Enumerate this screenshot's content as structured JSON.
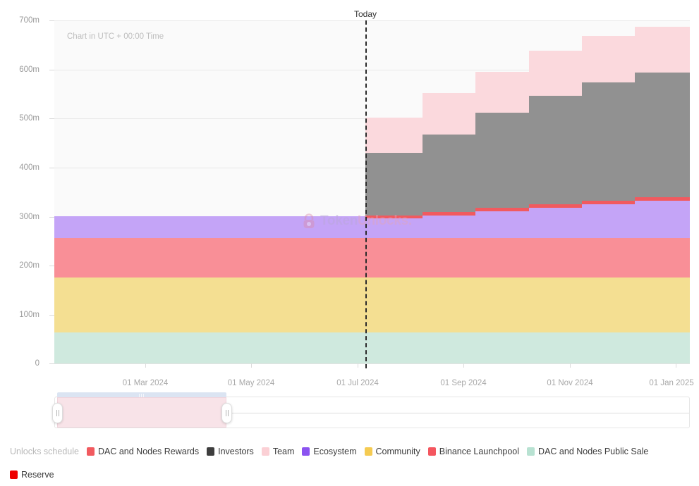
{
  "chart_data": {
    "type": "area",
    "title": "",
    "subtitle": "Chart in UTC + 00:00 Time",
    "xlabel": "",
    "ylabel": "",
    "ylim": [
      0,
      700000000
    ],
    "y_ticks": [
      "0",
      "100m",
      "200m",
      "300m",
      "400m",
      "500m",
      "600m",
      "700m"
    ],
    "y_tick_values": [
      0,
      100000000,
      200000000,
      300000000,
      400000000,
      500000000,
      600000000,
      700000000
    ],
    "x_ticks": [
      "01 Mar 2024",
      "01 May 2024",
      "01 Jul 2024",
      "01 Sep 2024",
      "01 Nov 2024",
      "01 Jan 2025"
    ],
    "grid": true,
    "legend_position": "bottom",
    "stacked": true,
    "step_shape": "hv",
    "annotations": [
      {
        "name": "today-marker",
        "label": "Today",
        "x": "01 Jul 2024",
        "style": "dashed-vertical"
      },
      {
        "name": "timezone-note",
        "label": "Chart in UTC + 00:00 Time"
      },
      {
        "name": "watermark",
        "label": "TokenUnlocks."
      }
    ],
    "x": [
      "01 Feb 2024",
      "01 Jul 2024",
      "01 Aug 2024",
      "01 Sep 2024",
      "01 Oct 2024",
      "01 Nov 2024",
      "01 Dec 2024",
      "01 Jan 2025"
    ],
    "series": [
      {
        "name": "DAC and Nodes Public Sale",
        "color": "#cfe9de",
        "values": [
          50000000,
          50000000,
          50000000,
          50000000,
          50000000,
          50000000,
          50000000,
          50000000
        ]
      },
      {
        "name": "Community",
        "color": "#f4df92",
        "values": [
          130000000,
          130000000,
          130000000,
          130000000,
          130000000,
          130000000,
          130000000,
          130000000
        ]
      },
      {
        "name": "Binance Launchpool",
        "color": "#f98f97",
        "values": [
          75000000,
          75000000,
          75000000,
          75000000,
          75000000,
          75000000,
          75000000,
          75000000
        ]
      },
      {
        "name": "Ecosystem",
        "color": "#c4a4f7",
        "values": [
          45000000,
          45000000,
          45000000,
          45000000,
          45000000,
          45000000,
          45000000,
          45000000
        ]
      },
      {
        "name": "DAC and Nodes Rewards",
        "color": "#f15a5f",
        "values": [
          0,
          3000000,
          5000000,
          7000000,
          9000000,
          11000000,
          13000000,
          15000000
        ]
      },
      {
        "name": "Investors",
        "color": "#919191",
        "values": [
          0,
          110000000,
          125000000,
          140000000,
          155000000,
          170000000,
          185000000,
          197000000
        ]
      },
      {
        "name": "Team",
        "color": "#fbd9dd",
        "values": [
          0,
          72000000,
          88000000,
          97000000,
          110000000,
          118000000,
          127000000,
          133000000
        ]
      },
      {
        "name": "Reserve",
        "color": "#ee0000",
        "values": [
          0,
          0,
          0,
          0,
          0,
          0,
          0,
          0
        ]
      }
    ],
    "stack_totals": [
      "300m",
      "500m",
      "535m",
      "570m",
      "610m",
      "645m",
      "665m",
      "680m"
    ]
  },
  "legend": {
    "title": "Unlocks schedule",
    "items": [
      {
        "label": "DAC and Nodes Rewards",
        "color": "#f15a5f"
      },
      {
        "label": "Investors",
        "color": "#3e3e3e"
      },
      {
        "label": "Team",
        "color": "#fbd0d5"
      },
      {
        "label": "Ecosystem",
        "color": "#8b53f0"
      },
      {
        "label": "Community",
        "color": "#f5cb52"
      },
      {
        "label": "Binance Launchpool",
        "color": "#f4565f"
      },
      {
        "label": "DAC and Nodes Public Sale",
        "color": "#b8e2d2"
      },
      {
        "label": "Reserve",
        "color": "#ee0000"
      }
    ]
  },
  "range_slider": {
    "name": "date-range-slider",
    "selection_start_pct": 0,
    "selection_end_pct": 27
  }
}
